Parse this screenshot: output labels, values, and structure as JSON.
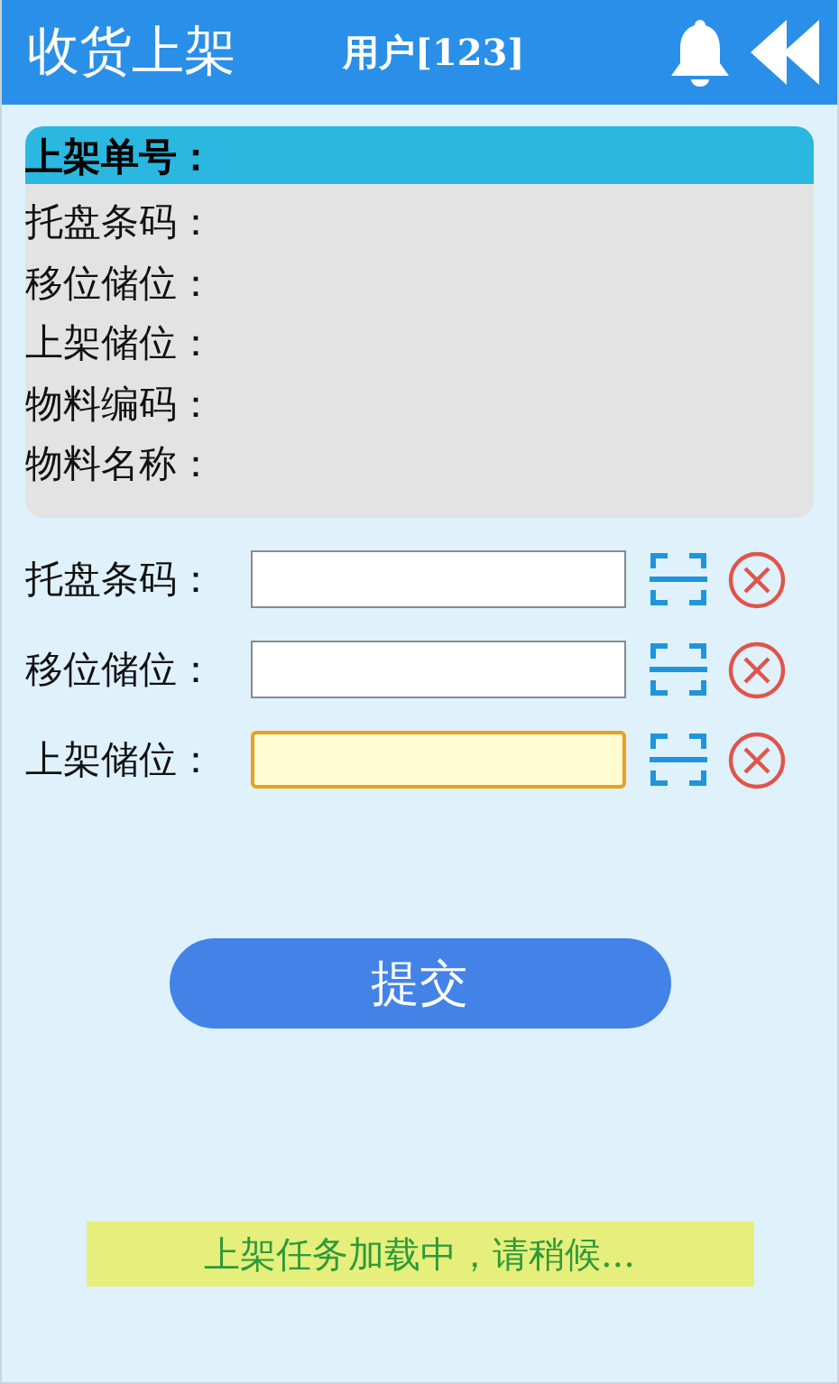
{
  "header": {
    "title": "收货上架",
    "user": "用户[123]"
  },
  "info_card": {
    "title": "上架单号：",
    "rows": [
      {
        "label": "托盘条码："
      },
      {
        "label": "移位储位："
      },
      {
        "label": "上架储位："
      },
      {
        "label": "物料编码："
      },
      {
        "label": "物料名称："
      }
    ]
  },
  "form": [
    {
      "label": "托盘条码：",
      "focused": false
    },
    {
      "label": "移位储位：",
      "focused": false
    },
    {
      "label": "上架储位：",
      "focused": true
    }
  ],
  "submit_button": "提交",
  "status_message": "上架任务加载中，请稍候..."
}
